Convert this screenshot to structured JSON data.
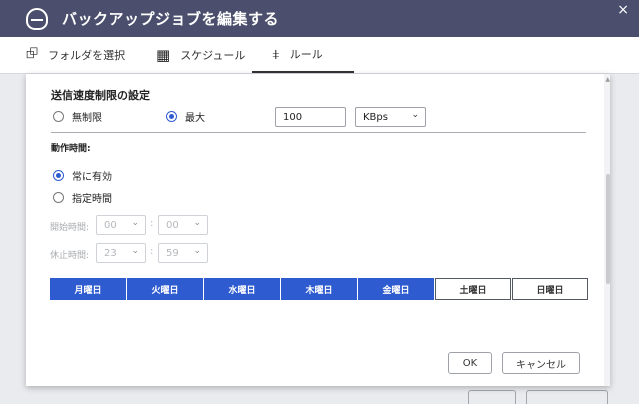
{
  "window": {
    "title": "バックアップジョブを編集する",
    "close_glyph": "×"
  },
  "tabs": [
    {
      "label": "フォルダを選択",
      "icon": "folder-arrow-icon",
      "glyph": "⮺"
    },
    {
      "label": "スケジュール",
      "icon": "calendar-icon",
      "glyph": "▦"
    },
    {
      "label": "ルール",
      "icon": "sliders-icon",
      "glyph": "⧧"
    }
  ],
  "speed": {
    "title": "送信速度制限の設定",
    "unlimited_label": "無制限",
    "max_label": "最大",
    "selected": "max",
    "value": "100",
    "unit": "KBps"
  },
  "schedule": {
    "title": "動作時間:",
    "always_label": "常に有効",
    "specified_label": "指定時間",
    "selected": "always",
    "start_label": "開始時間:",
    "start_hour": "00",
    "start_min": "00",
    "stop_label": "休止時間:",
    "stop_hour": "23",
    "stop_min": "59",
    "colon": ":"
  },
  "days": [
    {
      "label": "月曜日",
      "on": true
    },
    {
      "label": "火曜日",
      "on": true
    },
    {
      "label": "水曜日",
      "on": true
    },
    {
      "label": "木曜日",
      "on": true
    },
    {
      "label": "金曜日",
      "on": true
    },
    {
      "label": "土曜日",
      "on": false
    },
    {
      "label": "日曜日",
      "on": false
    }
  ],
  "buttons": {
    "ok": "OK",
    "cancel": "キャンセル"
  },
  "colors": {
    "titlebar": "#4b4f6d",
    "accent": "#2f5bd0"
  }
}
